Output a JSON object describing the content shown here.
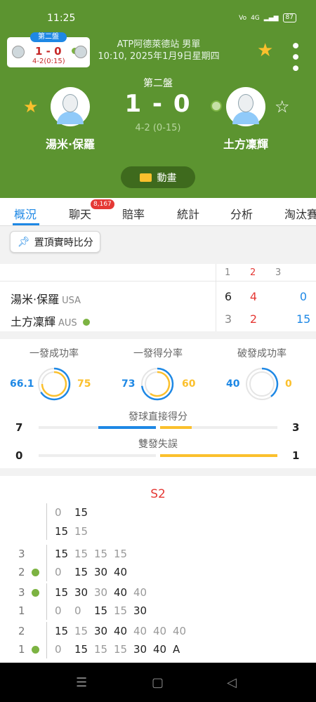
{
  "status_bar": {
    "time": "11:25",
    "network": "4G",
    "battery": "87"
  },
  "mini_score": {
    "tag": "第二盤",
    "score": "1 - 0",
    "sub": "4-2(0:15)"
  },
  "header": {
    "tournament": "ATP阿德萊德站 男單",
    "datetime": "10:10, 2025年1月9日星期四",
    "set_label": "第二盤",
    "score": "1 - 0",
    "sub_score": "4-2 (0-15)",
    "player1": "湯米·保羅",
    "player2": "土方凜輝",
    "animation_label": "動畫"
  },
  "tabs": [
    {
      "label": "概況",
      "active": true
    },
    {
      "label": "聊天",
      "badge": "8,167"
    },
    {
      "label": "賠率"
    },
    {
      "label": "統計"
    },
    {
      "label": "分析"
    },
    {
      "label": "淘汰賽"
    }
  ],
  "pin_button": "置頂實時比分",
  "score_table": {
    "set_headers": [
      "1",
      "2",
      "3"
    ],
    "rows": [
      {
        "name": "湯米·保羅",
        "country": "USA",
        "sets": [
          "6",
          "4"
        ],
        "points": "0",
        "serving": false
      },
      {
        "name": "土方凜輝",
        "country": "AUS",
        "sets": [
          "3",
          "2"
        ],
        "points": "15",
        "serving": true
      }
    ]
  },
  "stats": {
    "donuts": [
      {
        "label": "一發成功率",
        "left": "66.1",
        "right": "75",
        "left_frac": 0.661,
        "right_frac": 0.75
      },
      {
        "label": "一發得分率",
        "left": "73",
        "right": "60",
        "left_frac": 0.73,
        "right_frac": 0.6
      },
      {
        "label": "破發成功率",
        "left": "40",
        "right": "0",
        "left_frac": 0.4,
        "right_frac": 0.0
      }
    ],
    "bars": [
      {
        "label": "發球直接得分",
        "left": "7",
        "right": "3",
        "left_val": 7,
        "right_val": 3
      },
      {
        "label": "雙發失誤",
        "left": "0",
        "right": "1",
        "left_val": 0,
        "right_val": 1
      }
    ]
  },
  "pbp": {
    "set_title": "S2",
    "games": [
      {
        "score_top": "",
        "score_bottom": "",
        "serve_top": false,
        "serve_bottom": false,
        "top": [
          [
            "0",
            true
          ],
          [
            "15",
            false
          ]
        ],
        "bottom": [
          [
            "15",
            false
          ],
          [
            "15",
            true
          ]
        ]
      },
      {
        "score_top": "3",
        "score_bottom": "2",
        "serve_top": false,
        "serve_bottom": true,
        "top": [
          [
            "15",
            false
          ],
          [
            "15",
            true
          ],
          [
            "15",
            true
          ],
          [
            "15",
            true
          ]
        ],
        "bottom": [
          [
            "0",
            true
          ],
          [
            "15",
            false
          ],
          [
            "30",
            false
          ],
          [
            "40",
            false
          ]
        ]
      },
      {
        "score_top": "3",
        "score_bottom": "1",
        "serve_top": true,
        "serve_bottom": false,
        "top": [
          [
            "15",
            false
          ],
          [
            "30",
            false
          ],
          [
            "30",
            true
          ],
          [
            "40",
            false
          ],
          [
            "40",
            true
          ]
        ],
        "bottom": [
          [
            "0",
            true
          ],
          [
            "0",
            true
          ],
          [
            "15",
            false
          ],
          [
            "15",
            true
          ],
          [
            "30",
            false
          ]
        ]
      },
      {
        "score_top": "2",
        "score_bottom": "1",
        "serve_top": false,
        "serve_bottom": true,
        "top": [
          [
            "15",
            false
          ],
          [
            "15",
            true
          ],
          [
            "30",
            false
          ],
          [
            "40",
            false
          ],
          [
            "40",
            true
          ],
          [
            "40",
            true
          ],
          [
            "40",
            true
          ]
        ],
        "bottom": [
          [
            "0",
            true
          ],
          [
            "15",
            false
          ],
          [
            "15",
            true
          ],
          [
            "15",
            true
          ],
          [
            "30",
            false
          ],
          [
            "40",
            false
          ],
          [
            "A",
            false
          ]
        ]
      }
    ]
  },
  "colors": {
    "header_green": "#5c9430",
    "accent_blue": "#1e88e5",
    "accent_yellow": "#fbc02d",
    "score_red": "#e53935"
  }
}
